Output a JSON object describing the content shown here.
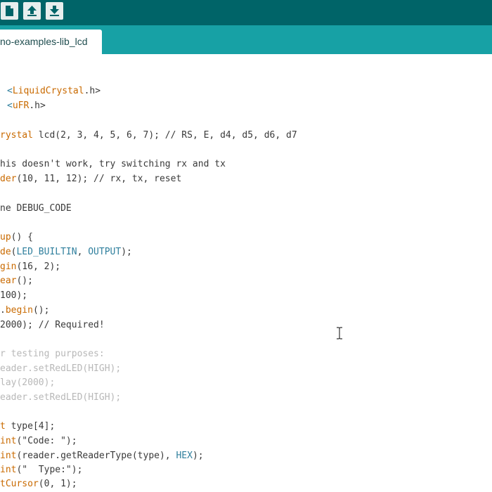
{
  "toolbar": {
    "buttons": [
      "new-file",
      "open-file",
      "save-file"
    ]
  },
  "tab": {
    "label": "no-examples-lib_lcd"
  },
  "code": {
    "l1": [
      "<",
      "LiquidCrystal",
      ".h>"
    ],
    "l2": [
      "<",
      "uFR",
      ".h>"
    ],
    "l3": [
      "rystal",
      " lcd(2, 3, 4, 5, 6, 7); // RS, E, d4, d5, d6, d7"
    ],
    "l4": [
      "his doesn't work, try switching rx and tx"
    ],
    "l5": [
      "der",
      "(10, 11, 12); // rx, tx, reset"
    ],
    "l6": [
      "ne DEBUG_CODE"
    ],
    "l7": [
      "up",
      "() {"
    ],
    "l8": [
      "de",
      "(",
      "LED_BUILTIN",
      ", ",
      "OUTPUT",
      ");"
    ],
    "l9": [
      "gin",
      "(16, 2);"
    ],
    "l10": [
      "ear",
      "();"
    ],
    "l11": [
      "100);"
    ],
    "l12": [
      ".",
      "begin",
      "();"
    ],
    "l13": [
      "2000); // Required!"
    ],
    "l14": [
      "r testing purposes:"
    ],
    "l15": [
      "eader.setRedLED(HIGH);"
    ],
    "l16": [
      "lay(2000);"
    ],
    "l17": [
      "eader.setRedLED(HIGH);"
    ],
    "l18": [
      "t",
      " type[4];"
    ],
    "l19": [
      "int",
      "(\"Code: \");"
    ],
    "l20": [
      "int",
      "(reader.getReaderType(type), ",
      "HEX",
      ");"
    ],
    "l21": [
      "int",
      "(\"  Type:\");"
    ],
    "l22": [
      "tCursor",
      "(0, 1);"
    ]
  },
  "colors": {
    "toolbar": "#006468",
    "tabbar": "#17a1a5",
    "keyword_orange": "#c96a00",
    "keyword_blue": "#2f7f9d",
    "comment_gray": "#b8b8b8"
  }
}
